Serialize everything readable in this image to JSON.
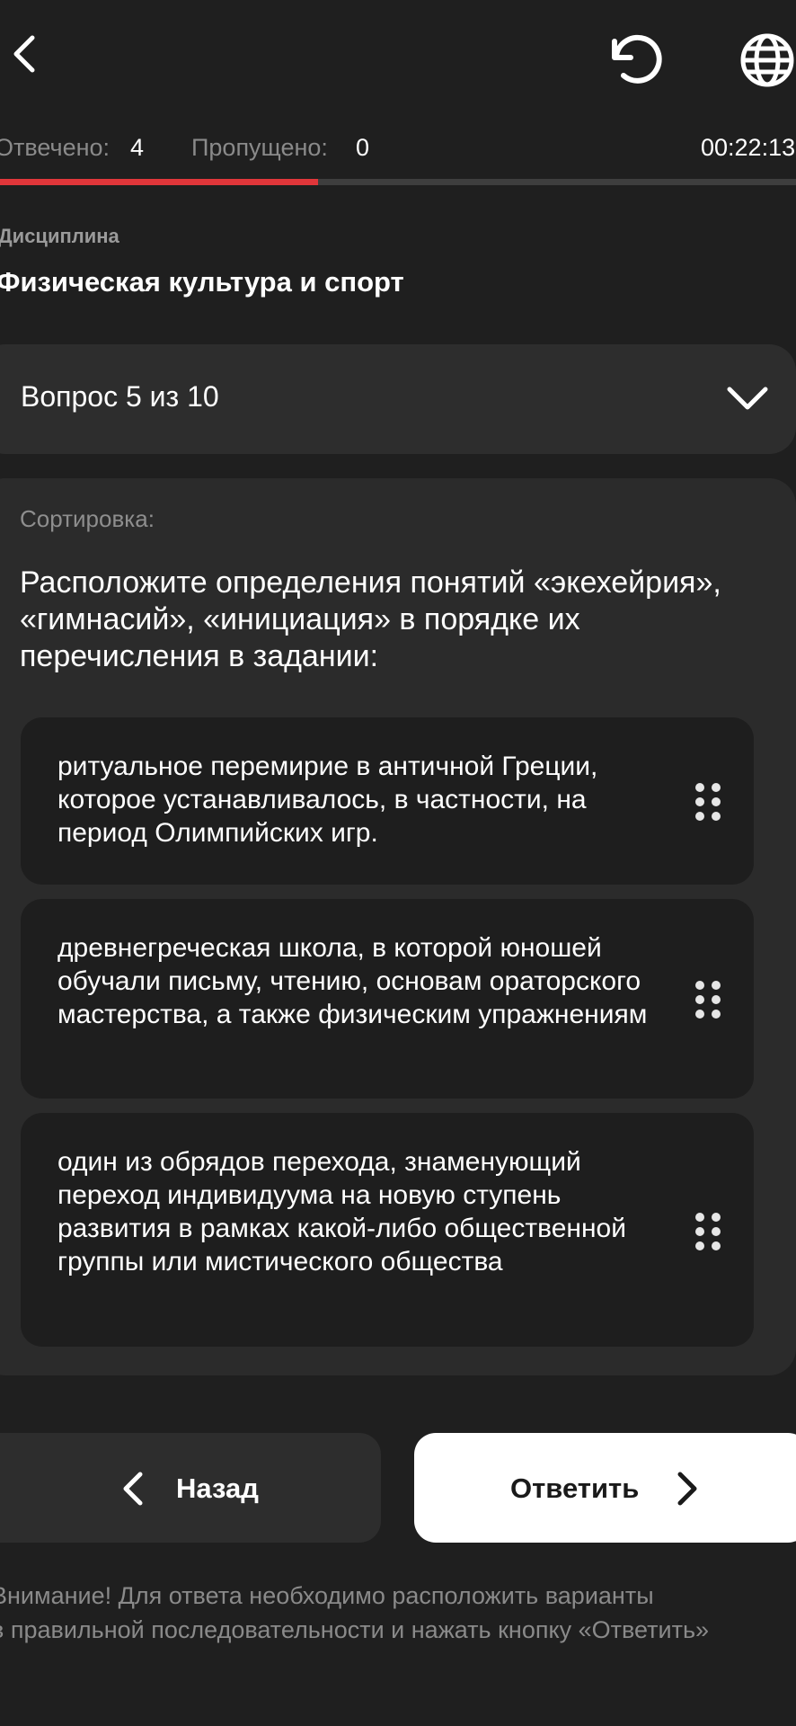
{
  "header": {
    "back_icon": "chevron-left-icon",
    "reset_icon": "refresh-icon",
    "language_icon": "globe-icon"
  },
  "stats": {
    "answered_label": "Отвечено:",
    "answered_value": "4",
    "skipped_label": "Пропущено:",
    "skipped_value": "0",
    "timer": "00:22:13"
  },
  "progress": {
    "fraction": 0.4,
    "color": "#e0363a"
  },
  "discipline": {
    "label": "Дисциплина",
    "title": "Физическая культура и спорт"
  },
  "question_selector": {
    "label": "Вопрос 5 из 10",
    "icon": "chevron-down-icon"
  },
  "question": {
    "type_label": "Сортировка:",
    "text": "Расположите определения понятий «экехейрия», «гимнасий», «инициация» в порядке их перечисления в задании:",
    "items": [
      {
        "text": "ритуальное перемирие в античной Греции, которое устанавливалось, в частности, на период Олимпийских игр."
      },
      {
        "text": "древнегреческая школа, в которой юношей обучали письму, чтению, основам ораторского мастерства, а также физическим упражнениям"
      },
      {
        "text": "один из обрядов перехода, знаменующий переход индивидуума на новую ступень развития в рамках какой-либо общественной группы или мистического общества"
      }
    ]
  },
  "buttons": {
    "back_label": "Назад",
    "answer_label": "Ответить"
  },
  "notice": {
    "line1": "Внимание! Для ответа необходимо расположить варианты",
    "line2": "в правильной последовательности и нажать кнопку «Ответить»"
  }
}
